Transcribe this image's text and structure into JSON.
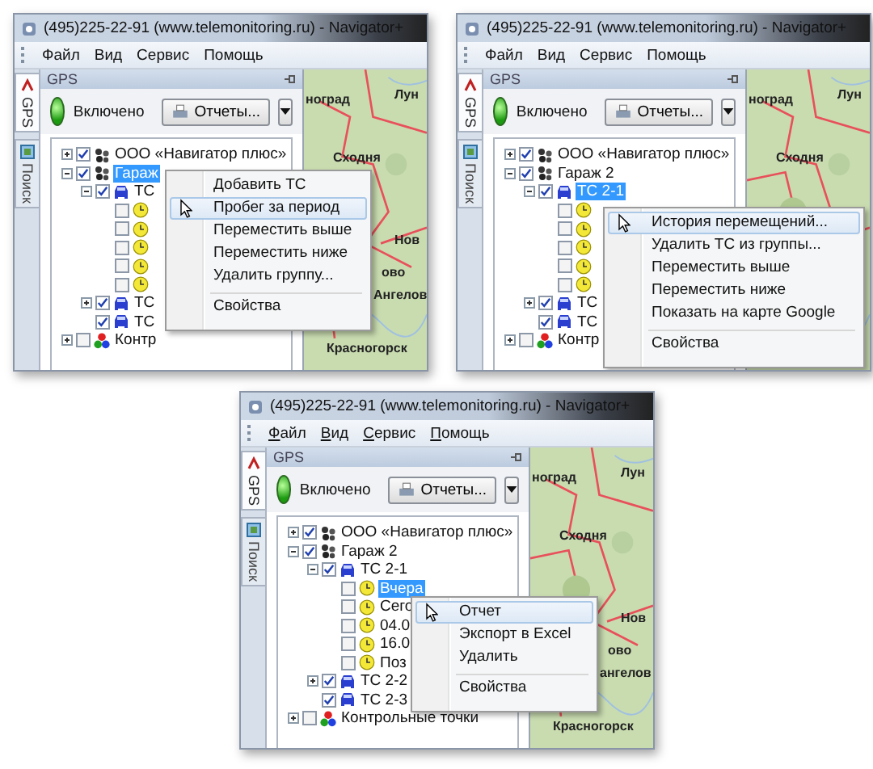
{
  "panels": [
    {
      "window": {
        "title": "(495)225-22-91  (www.telemonitoring.ru) - Navigator+"
      },
      "menu_bar": {
        "underline_access_keys": false,
        "items": [
          "Файл",
          "Вид",
          "Сервис",
          "Помощь"
        ]
      },
      "side_tabs": [
        {
          "label": "GPS",
          "selected": true
        },
        {
          "label": "Поиск",
          "selected": false
        }
      ],
      "panel_title": "GPS",
      "status": {
        "label": "Включено",
        "on": true
      },
      "reports_button": "Отчеты...",
      "tree": [
        {
          "label": "ООО «Навигатор плюс»",
          "kind": "group",
          "checked": true,
          "expanded": false,
          "selected": false
        },
        {
          "label": "Гараж",
          "kind": "group",
          "checked": true,
          "expanded": true,
          "selected": true,
          "children": [
            {
              "label": "ТС",
              "kind": "vehicle",
              "checked": true,
              "expanded": true,
              "selected": false,
              "children": [
                {
                  "kind": "period",
                  "checked": false,
                  "selected": false
                },
                {
                  "kind": "period",
                  "checked": false,
                  "selected": false
                },
                {
                  "kind": "period",
                  "checked": false,
                  "selected": false
                },
                {
                  "kind": "period",
                  "checked": false,
                  "selected": false
                },
                {
                  "kind": "period",
                  "checked": false,
                  "selected": false
                }
              ]
            },
            {
              "label": "ТС",
              "kind": "vehicle",
              "checked": true,
              "expanded": false,
              "selected": false
            },
            {
              "label": "ТС",
              "kind": "vehicle",
              "checked": true,
              "selected": false
            }
          ]
        },
        {
          "label": "Контр",
          "kind": "points",
          "checked": false,
          "expanded": false,
          "selected": false
        }
      ],
      "context_menu": [
        {
          "label": "Добавить ТС",
          "selected": false,
          "separator_before": false
        },
        {
          "label": "Пробег за период",
          "selected": true,
          "separator_before": false
        },
        {
          "label": "Переместить выше",
          "selected": false,
          "separator_before": false
        },
        {
          "label": "Переместить ниже",
          "selected": false,
          "separator_before": false
        },
        {
          "label": "Удалить группу...",
          "selected": false,
          "separator_before": false
        },
        {
          "label": "Свойства",
          "selected": false,
          "separator_before": true
        }
      ],
      "map_labels": [
        "ноград",
        "Лун",
        "Сходня",
        "Нов",
        "ово",
        "Ангелов",
        "Красногорск"
      ]
    },
    {
      "window": {
        "title": "(495)225-22-91  (www.telemonitoring.ru) - Navigator+"
      },
      "menu_bar": {
        "underline_access_keys": false,
        "items": [
          "Файл",
          "Вид",
          "Сервис",
          "Помощь"
        ]
      },
      "side_tabs": [
        {
          "label": "GPS",
          "selected": true
        },
        {
          "label": "Поиск",
          "selected": false
        }
      ],
      "panel_title": "GPS",
      "status": {
        "label": "Включено",
        "on": true
      },
      "reports_button": "Отчеты...",
      "tree": [
        {
          "label": "ООО «Навигатор плюс»",
          "kind": "group",
          "checked": true,
          "expanded": false,
          "selected": false
        },
        {
          "label": "Гараж 2",
          "kind": "group",
          "checked": true,
          "expanded": true,
          "selected": false,
          "children": [
            {
              "label": "ТС 2-1",
              "kind": "vehicle",
              "checked": true,
              "expanded": true,
              "selected": true,
              "children": [
                {
                  "kind": "period",
                  "checked": false,
                  "selected": false
                },
                {
                  "kind": "period",
                  "checked": false,
                  "selected": false
                },
                {
                  "kind": "period",
                  "checked": false,
                  "selected": false
                },
                {
                  "kind": "period",
                  "checked": false,
                  "selected": false
                },
                {
                  "kind": "period",
                  "checked": false,
                  "selected": false
                }
              ]
            },
            {
              "label": "ТС",
              "kind": "vehicle",
              "checked": true,
              "expanded": false,
              "selected": false
            },
            {
              "label": "ТС",
              "kind": "vehicle",
              "checked": true,
              "selected": false
            }
          ]
        },
        {
          "label": "Контр",
          "kind": "points",
          "checked": false,
          "expanded": false,
          "selected": false
        }
      ],
      "context_menu": [
        {
          "label": "История перемещений...",
          "selected": true,
          "separator_before": false
        },
        {
          "label": "Удалить ТС из группы...",
          "selected": false,
          "separator_before": false
        },
        {
          "label": "Переместить выше",
          "selected": false,
          "separator_before": false
        },
        {
          "label": "Переместить ниже",
          "selected": false,
          "separator_before": false
        },
        {
          "label": "Показать на карте Google",
          "selected": false,
          "separator_before": false
        },
        {
          "label": "Свойства",
          "selected": false,
          "separator_before": true
        }
      ],
      "map_labels": [
        "ноград",
        "Лун",
        "Сходня"
      ]
    },
    {
      "window": {
        "title": "(495)225-22-91  (www.telemonitoring.ru) - Navigator+"
      },
      "menu_bar": {
        "underline_access_keys": true,
        "items": [
          "Файл",
          "Вид",
          "Сервис",
          "Помощь"
        ]
      },
      "side_tabs": [
        {
          "label": "GPS",
          "selected": true
        },
        {
          "label": "Поиск",
          "selected": false
        }
      ],
      "panel_title": "GPS",
      "status": {
        "label": "Включено",
        "on": true
      },
      "reports_button": "Отчеты...",
      "tree": [
        {
          "label": "ООО «Навигатор плюс»",
          "kind": "group",
          "checked": true,
          "expanded": false,
          "selected": false
        },
        {
          "label": "Гараж 2",
          "kind": "group",
          "checked": true,
          "expanded": true,
          "selected": false,
          "children": [
            {
              "label": "ТС 2-1",
              "kind": "vehicle",
              "checked": true,
              "expanded": true,
              "selected": false,
              "children": [
                {
                  "label": "Вчера",
                  "kind": "period",
                  "checked": false,
                  "selected": true
                },
                {
                  "label": "Сего",
                  "kind": "period",
                  "checked": false,
                  "selected": false
                },
                {
                  "label": "04.0",
                  "kind": "period",
                  "checked": false,
                  "selected": false
                },
                {
                  "label": "16.0",
                  "kind": "period",
                  "checked": false,
                  "selected": false
                },
                {
                  "label": "Поз",
                  "kind": "period",
                  "checked": false,
                  "selected": false
                }
              ]
            },
            {
              "label": "ТС 2-2",
              "kind": "vehicle",
              "checked": true,
              "expanded": false,
              "selected": false
            },
            {
              "label": "ТС 2-3",
              "kind": "vehicle",
              "checked": true,
              "selected": false
            }
          ]
        },
        {
          "label": "Контрольные точки",
          "kind": "points",
          "checked": false,
          "expanded": false,
          "selected": false
        }
      ],
      "context_menu": [
        {
          "label": "Отчет",
          "selected": true,
          "separator_before": false
        },
        {
          "label": "Экспорт в Excel",
          "selected": false,
          "separator_before": false
        },
        {
          "label": "Удалить",
          "selected": false,
          "separator_before": false
        },
        {
          "label": "Свойства",
          "selected": false,
          "separator_before": true
        }
      ],
      "map_labels": [
        "ноград",
        "Лун",
        "Сходня",
        "Нов",
        "ово",
        "ангелов",
        "Красногорск"
      ]
    }
  ]
}
